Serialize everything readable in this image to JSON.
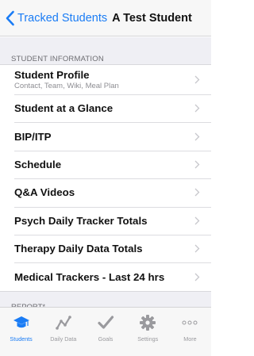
{
  "nav": {
    "back_label": "Tracked Students",
    "title": "A Test Student"
  },
  "sections": {
    "student_information": "STUDENT INFORMATION",
    "report": "REPORT*"
  },
  "rows": [
    {
      "label": "Student Profile",
      "sub": "Contact, Team, Wiki, Meal Plan"
    },
    {
      "label": "Student at a Glance"
    },
    {
      "label": "BIP/ITP"
    },
    {
      "label": "Schedule"
    },
    {
      "label": "Q&A Videos"
    },
    {
      "label": "Psych Daily Tracker Totals"
    },
    {
      "label": "Therapy Daily Data Totals"
    },
    {
      "label": "Medical Trackers - Last 24 hrs"
    }
  ],
  "tabs": [
    {
      "label": "Students",
      "icon": "graduation-cap-icon",
      "active": true
    },
    {
      "label": "Daily Data",
      "icon": "line-chart-icon",
      "active": false
    },
    {
      "label": "Goals",
      "icon": "checkmark-icon",
      "active": false
    },
    {
      "label": "Settings",
      "icon": "gear-icon",
      "active": false
    },
    {
      "label": "More",
      "icon": "more-dots-icon",
      "active": false
    }
  ],
  "colors": {
    "accent": "#1a7cf5",
    "inactive": "#9a9a9e",
    "grouped_background": "#efeff4"
  }
}
